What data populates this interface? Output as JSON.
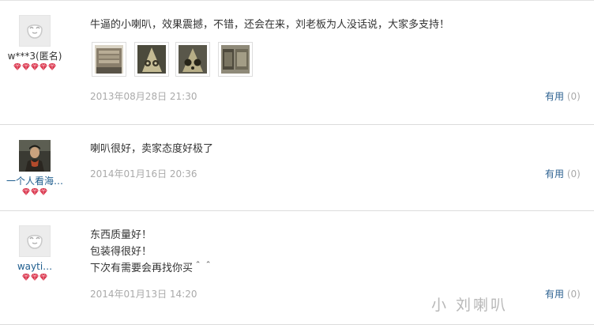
{
  "reviews": [
    {
      "username": "w***3(匿名)",
      "avatar_icon": "default-avatar-icon",
      "rating_gems": 5,
      "comment_lines": [
        "牛逼的小喇叭，效果震撼，不错，还会在来，刘老板为人没话说，大家多支持！"
      ],
      "photos": [
        "photo-thumbnail-1",
        "photo-thumbnail-2",
        "photo-thumbnail-3",
        "photo-thumbnail-4"
      ],
      "date": "2013年08月28日 21:30",
      "useful_label": "有用",
      "useful_count": "(0)"
    },
    {
      "username": "一个人看海…",
      "avatar_icon": "user-photo-avatar",
      "rating_gems": 3,
      "comment_lines": [
        "喇叭很好，卖家态度好极了"
      ],
      "photos": [],
      "date": "2014年01月16日 20:36",
      "useful_label": "有用",
      "useful_count": "(0)"
    },
    {
      "username": "wayti…",
      "avatar_icon": "default-avatar-icon",
      "rating_gems": 3,
      "comment_lines": [
        "东西质量好！",
        "包装得很好！",
        "下次有需要会再找你买＾＾"
      ],
      "photos": [],
      "date": "2014年01月13日 14:20",
      "useful_label": "有用",
      "useful_count": "(0)"
    }
  ],
  "watermark": "小 刘喇叭",
  "colors": {
    "gem": "#d8334a",
    "link": "#1f5d8e",
    "date": "#aaaaaa",
    "divider": "#dcdcdc"
  }
}
